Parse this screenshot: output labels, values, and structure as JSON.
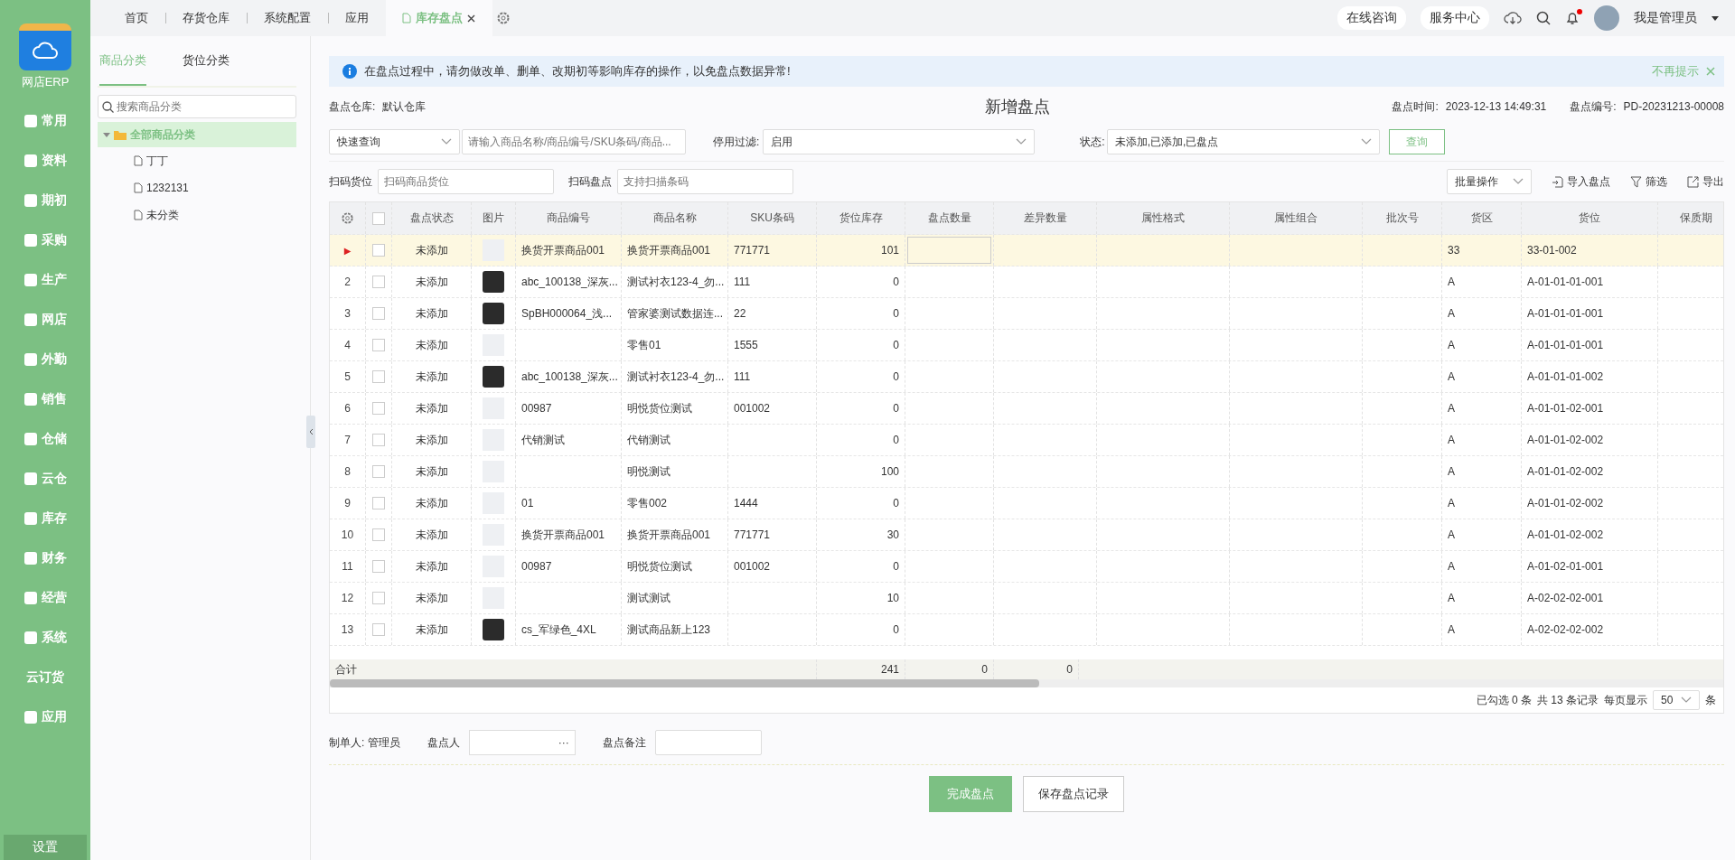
{
  "app": {
    "logo_label": "网店ERP"
  },
  "sidebar": {
    "items": [
      {
        "label": "常用",
        "icon": true
      },
      {
        "label": "资料",
        "icon": true
      },
      {
        "label": "期初",
        "icon": true
      },
      {
        "label": "采购",
        "icon": true
      },
      {
        "label": "生产",
        "icon": true
      },
      {
        "label": "网店",
        "icon": true
      },
      {
        "label": "外勤",
        "icon": true
      },
      {
        "label": "销售",
        "icon": true
      },
      {
        "label": "仓储",
        "icon": true
      },
      {
        "label": "云仓",
        "icon": true
      },
      {
        "label": "库存",
        "icon": true
      },
      {
        "label": "财务",
        "icon": true
      },
      {
        "label": "经营",
        "icon": true
      },
      {
        "label": "系统",
        "icon": true
      },
      {
        "label": "云订货",
        "icon": false
      },
      {
        "label": "应用",
        "icon": true
      }
    ],
    "settings": "设置"
  },
  "tabs": [
    {
      "label": "首页",
      "selected": false
    },
    {
      "label": "存货仓库",
      "selected": false
    },
    {
      "label": "系统配置",
      "selected": false
    },
    {
      "label": "应用",
      "selected": false
    },
    {
      "label": "库存盘点",
      "selected": true
    }
  ],
  "header": {
    "links": [
      "在线咨询",
      "服务中心"
    ],
    "notification": true,
    "user": "我是管理员"
  },
  "category_panel": {
    "tabs": [
      {
        "label": "商品分类",
        "selected": true
      },
      {
        "label": "货位分类",
        "selected": false
      }
    ],
    "search_placeholder": "搜索商品分类",
    "tree": [
      {
        "label": "全部商品分类",
        "selected": true,
        "expanded": true,
        "children": [
          {
            "label": "丁丁"
          },
          {
            "label": "1232131"
          },
          {
            "label": "未分类"
          }
        ]
      }
    ]
  },
  "notice": {
    "text": "在盘点过程中，请勿做改单、删单、改期初等影响库存的操作，以免盘点数据异常!",
    "dismiss": "不再提示"
  },
  "form": {
    "title": "新增盘点",
    "warehouse_label": "盘点仓库:",
    "warehouse": "默认仓库",
    "time_label": "盘点时间:",
    "time": "2023-12-13 14:49:31",
    "number_label": "盘点编号:",
    "number": "PD-20231213-00008"
  },
  "filters": {
    "quick_query": "快速查询",
    "keyword_placeholder": "请输入商品名称/商品编号/SKU条码/商品...",
    "disabled_filter_label": "停用过滤:",
    "disabled_filter": "启用",
    "status_label": "状态:",
    "status": "未添加,已添加,已盘点",
    "query_button": "查询"
  },
  "scan": {
    "location_label": "扫码货位",
    "location_placeholder": "扫码商品货位",
    "count_label": "扫码盘点",
    "count_placeholder": "支持扫描条码"
  },
  "toolbar": {
    "batch": "批量操作",
    "import": "导入盘点",
    "filter": "筛选",
    "export": "导出"
  },
  "table": {
    "columns": [
      "盘点状态",
      "图片",
      "商品编号",
      "商品名称",
      "SKU条码",
      "货位库存",
      "盘点数量",
      "差异数量",
      "属性格式",
      "属性组合",
      "批次号",
      "货区",
      "货位",
      "保质期"
    ],
    "all_checked": false,
    "rows": [
      {
        "index": "▶",
        "selected": true,
        "checked": false,
        "status": "未添加",
        "kind": "placeholder",
        "code": "换货开票商品001",
        "name": "换货开票商品001",
        "sku": "771771",
        "stock": "101",
        "zone": "33",
        "location": "33-01-002"
      },
      {
        "index": "2",
        "selected": false,
        "checked": false,
        "status": "未添加",
        "kind": "photo",
        "code": "abc_100138_深灰...",
        "name": "测试衬衣123-4_勿...",
        "sku": "111",
        "stock": "0",
        "zone": "A",
        "location": "A-01-01-01-001"
      },
      {
        "index": "3",
        "selected": false,
        "checked": false,
        "status": "未添加",
        "kind": "photo",
        "code": "SpBH000064_浅...",
        "name": "管家婆测试数据连...",
        "sku": "22",
        "stock": "0",
        "zone": "A",
        "location": "A-01-01-01-001"
      },
      {
        "index": "4",
        "selected": false,
        "checked": false,
        "status": "未添加",
        "kind": "placeholder",
        "name": "零售01",
        "sku": "1555",
        "stock": "0",
        "zone": "A",
        "location": "A-01-01-01-001"
      },
      {
        "index": "5",
        "selected": false,
        "checked": false,
        "status": "未添加",
        "kind": "photo",
        "code": "abc_100138_深灰...",
        "name": "测试衬衣123-4_勿...",
        "sku": "111",
        "stock": "0",
        "zone": "A",
        "location": "A-01-01-01-002"
      },
      {
        "index": "6",
        "selected": false,
        "checked": false,
        "status": "未添加",
        "kind": "placeholder",
        "code": "00987",
        "name": "明悦货位测试",
        "sku": "001002",
        "stock": "0",
        "zone": "A",
        "location": "A-01-01-02-001"
      },
      {
        "index": "7",
        "selected": false,
        "checked": false,
        "status": "未添加",
        "kind": "placeholder",
        "code": "代销测试",
        "name": "代销测试",
        "stock": "0",
        "zone": "A",
        "location": "A-01-01-02-002"
      },
      {
        "index": "8",
        "selected": false,
        "checked": false,
        "status": "未添加",
        "kind": "placeholder",
        "name": "明悦测试",
        "stock": "100",
        "zone": "A",
        "location": "A-01-01-02-002"
      },
      {
        "index": "9",
        "selected": false,
        "checked": false,
        "status": "未添加",
        "kind": "placeholder",
        "code": "01",
        "name": "零售002",
        "sku": "1444",
        "stock": "0",
        "zone": "A",
        "location": "A-01-01-02-002"
      },
      {
        "index": "10",
        "selected": false,
        "checked": false,
        "status": "未添加",
        "kind": "placeholder",
        "code": "换货开票商品001",
        "name": "换货开票商品001",
        "sku": "771771",
        "stock": "30",
        "zone": "A",
        "location": "A-01-01-02-002"
      },
      {
        "index": "11",
        "selected": false,
        "checked": false,
        "status": "未添加",
        "kind": "placeholder",
        "code": "00987",
        "name": "明悦货位测试",
        "sku": "001002",
        "stock": "0",
        "zone": "A",
        "location": "A-01-02-01-001"
      },
      {
        "index": "12",
        "selected": false,
        "checked": false,
        "status": "未添加",
        "kind": "placeholder",
        "name": "测试测试",
        "stock": "10",
        "zone": "A",
        "location": "A-02-02-02-001"
      },
      {
        "index": "13",
        "selected": false,
        "checked": false,
        "status": "未添加",
        "kind": "photo",
        "code": "cs_军绿色_4XL",
        "name": "测试商品新上123",
        "stock": "0",
        "zone": "A",
        "location": "A-02-02-02-002"
      }
    ],
    "totals": {
      "label": "合计",
      "stock": "241",
      "count": "0",
      "diff": "0"
    }
  },
  "pagination": {
    "selected_info": "已勾选 0 条",
    "total_info": "共 13 条记录",
    "per_page_label": "每页显示",
    "per_page": "50",
    "unit": "条"
  },
  "footer": {
    "creator": "制单人: 管理员",
    "counter_label": "盘点人",
    "counter_more": "···",
    "remark_label": "盘点备注",
    "complete_button": "完成盘点",
    "save_button": "保存盘点记录"
  }
}
